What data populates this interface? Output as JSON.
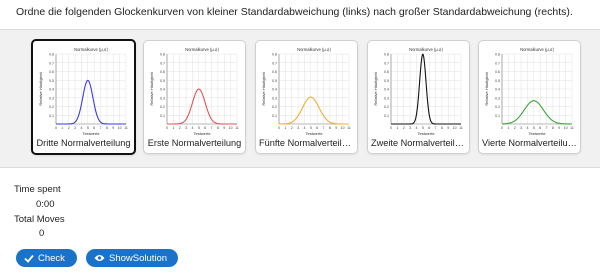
{
  "instruction": "Ordne die folgenden Glockenkurven von kleiner Standardabweichung (links) nach großer Standardabweichung (rechts).",
  "chart_common": {
    "title": "Normalkurve (μ,σ)",
    "xlabel": "Testwerte",
    "ylabel": "Relative Häufigkeit",
    "x_ticks": [
      "0",
      "1",
      "2",
      "3",
      "4",
      "5",
      "6",
      "7",
      "8",
      "9",
      "10",
      "11"
    ],
    "y_ticks": [
      "0.1",
      "0.2",
      "0.3",
      "0.4",
      "0.5",
      "0.6",
      "0.7",
      "0.8"
    ]
  },
  "chart_data": [
    {
      "type": "line",
      "label": "Dritte Normalverteilung",
      "mean": 5,
      "sd": 0.8,
      "color": "#3a3adf",
      "xlim": [
        0,
        11
      ],
      "ylim": [
        0,
        0.8
      ]
    },
    {
      "type": "line",
      "label": "Erste Normalverteilung",
      "mean": 5,
      "sd": 1.0,
      "color": "#e05555",
      "xlim": [
        0,
        11
      ],
      "ylim": [
        0,
        0.8
      ]
    },
    {
      "type": "line",
      "label": "Fünfte Normalverteilung",
      "mean": 5,
      "sd": 1.3,
      "color": "#f0b030",
      "xlim": [
        0,
        11
      ],
      "ylim": [
        0,
        0.8
      ]
    },
    {
      "type": "line",
      "label": "Zweite Normalverteilung",
      "mean": 5,
      "sd": 0.5,
      "color": "#111111",
      "xlim": [
        0,
        11
      ],
      "ylim": [
        0,
        0.8
      ]
    },
    {
      "type": "line",
      "label": "Vierte Normalverteilung",
      "mean": 5,
      "sd": 1.5,
      "color": "#3aa33a",
      "xlim": [
        0,
        11
      ],
      "ylim": [
        0,
        0.8
      ]
    }
  ],
  "cards": [
    {
      "label": "Dritte Normalverteilung",
      "selected": true
    },
    {
      "label": "Erste Normalverteilung",
      "selected": false
    },
    {
      "label": "Fünfte Normalverteilung",
      "selected": false
    },
    {
      "label": "Zweite Normalverteilung",
      "selected": false
    },
    {
      "label": "Vierte Normalverteilung",
      "selected": false
    }
  ],
  "stats": {
    "time_label": "Time spent",
    "time_value": "0:00",
    "moves_label": "Total Moves",
    "moves_value": "0"
  },
  "buttons": {
    "check_label": "Check",
    "check_icon": "check-icon",
    "solution_label": "ShowSolution",
    "solution_icon": "eye-icon"
  },
  "colors": {
    "accent": "#1a73c9",
    "selected_border": "#111111"
  }
}
